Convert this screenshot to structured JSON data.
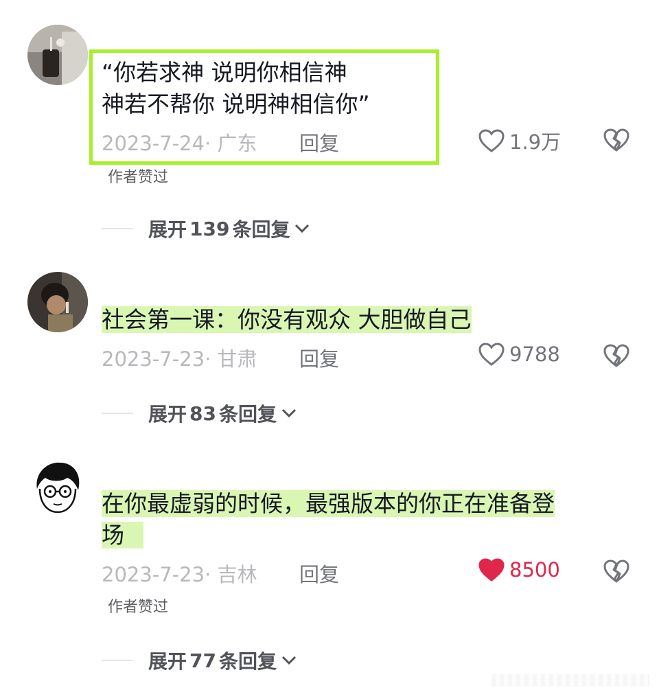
{
  "comments": [
    {
      "text_lines": [
        "“你若求神 说明你相信神",
        "神若不帮你 说明神相信你”"
      ],
      "date": "2023-7-24",
      "region": "广东",
      "reply_label": "回复",
      "likes": "1.9万",
      "liked": false,
      "author_liked": "作者赞过",
      "expand": {
        "prefix": "展开",
        "count": "139",
        "suffix": "条回复"
      }
    },
    {
      "text_lines": [
        "社会第一课：你没有观众 大胆做自己"
      ],
      "date": "2023-7-23",
      "region": "甘肃",
      "reply_label": "回复",
      "likes": "9788",
      "liked": false,
      "expand": {
        "prefix": "展开",
        "count": "83",
        "suffix": "条回复"
      }
    },
    {
      "text_lines": [
        "在你最虚弱的时候，最强版本的你正在准备登",
        "场"
      ],
      "date": "2023-7-23",
      "region": "吉林",
      "reply_label": "回复",
      "likes": "8500",
      "liked": true,
      "author_liked": "作者赞过",
      "expand": {
        "prefix": "展开",
        "count": "77",
        "suffix": "条回复"
      }
    }
  ],
  "colors": {
    "highlight_border": "#a8ef2c",
    "highlight_fill": "#d9f7b3",
    "liked_heart": "#e0264b",
    "meta_gray": "#b8b8bc"
  },
  "icons": [
    "heart-outline-icon",
    "heart-filled-icon",
    "broken-heart-icon",
    "chevron-down-icon"
  ]
}
